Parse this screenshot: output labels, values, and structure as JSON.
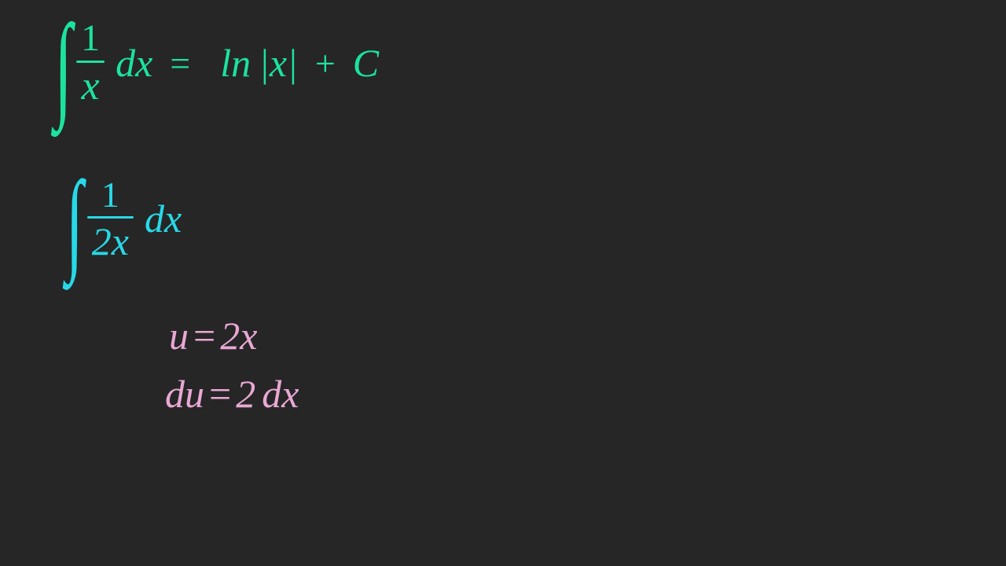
{
  "line1": {
    "integral_symbol": "∫",
    "numerator": "1",
    "denominator": "x",
    "diff": "dx",
    "equals": "=",
    "rhs_ln": "ln",
    "rhs_abs": "|x|",
    "plus": "+",
    "constant": "C"
  },
  "line2": {
    "integral_symbol": "∫",
    "numerator": "1",
    "denominator": "2x",
    "diff": "dx"
  },
  "line3": {
    "lhs": "u",
    "equals": "=",
    "rhs": "2x"
  },
  "line4": {
    "lhs": "du",
    "equals": "=",
    "rhs_a": "2",
    "rhs_b": "dx"
  }
}
